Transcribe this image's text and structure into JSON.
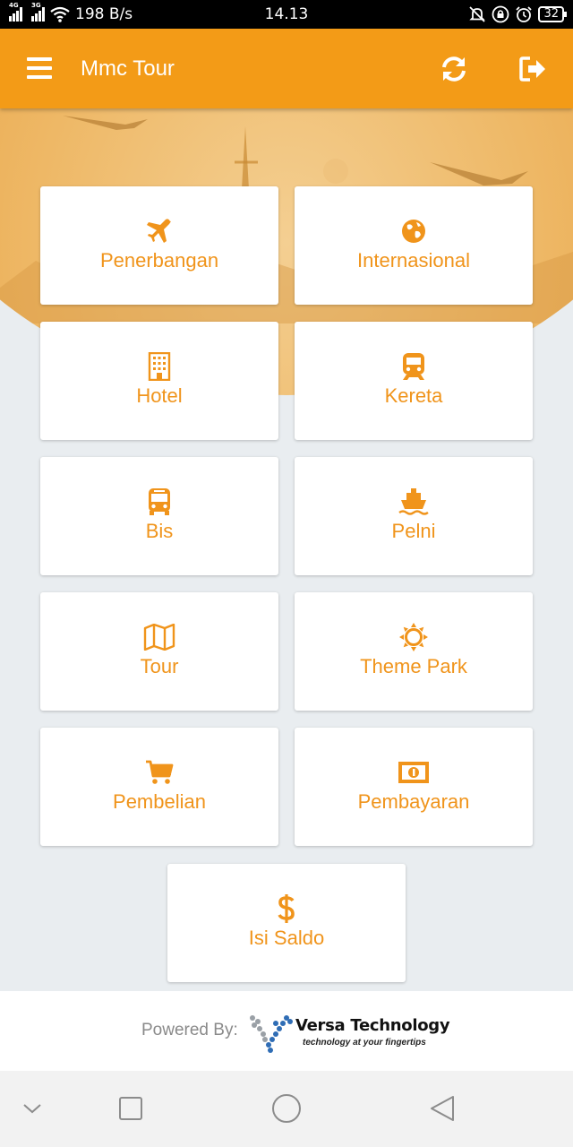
{
  "status_bar": {
    "net1": "4G",
    "net2": "3G",
    "speed": "198 B/s",
    "time": "14.13",
    "battery": "32"
  },
  "app_bar": {
    "title": "Mmc Tour"
  },
  "menu": [
    {
      "label": "Penerbangan",
      "icon": "airplane-icon"
    },
    {
      "label": "Internasional",
      "icon": "globe-icon"
    },
    {
      "label": "Hotel",
      "icon": "building-icon"
    },
    {
      "label": "Kereta",
      "icon": "train-icon"
    },
    {
      "label": "Bis",
      "icon": "bus-icon"
    },
    {
      "label": "Pelni",
      "icon": "ship-icon"
    },
    {
      "label": "Tour",
      "icon": "map-icon"
    },
    {
      "label": "Theme Park",
      "icon": "sun-icon"
    },
    {
      "label": "Pembelian",
      "icon": "cart-icon"
    },
    {
      "label": "Pembayaran",
      "icon": "money-icon"
    },
    {
      "label": "Isi Saldo",
      "icon": "dollar-icon"
    }
  ],
  "footer": {
    "powered_by": "Powered By:",
    "brand": "Versa Technology",
    "tagline": "technology at your fingertips"
  },
  "colors": {
    "accent": "#f39b17",
    "label": "#f0941b"
  }
}
